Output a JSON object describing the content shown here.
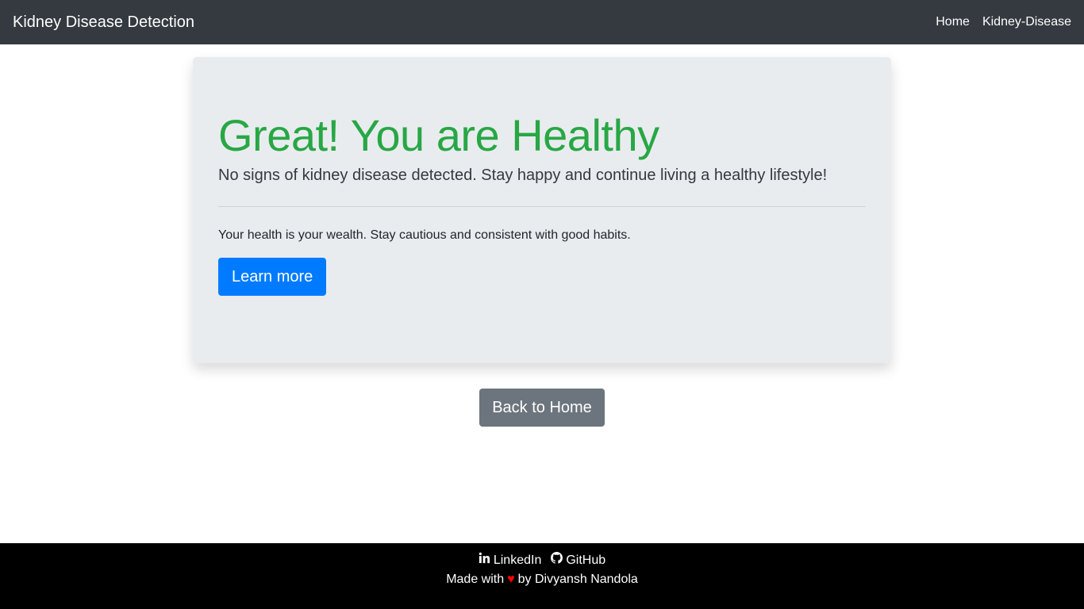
{
  "navbar": {
    "brand": "Kidney Disease Detection",
    "links": [
      "Home",
      "Kidney-Disease"
    ],
    "background": "#343a40"
  },
  "result": {
    "heading": "Great! You are Healthy",
    "lead": "No signs of kidney disease detected. Stay happy and continue living a healthy lifestyle!",
    "message": "Your health is your wealth. Stay cautious and consistent with good habits.",
    "learn_more_label": "Learn more",
    "heading_color": "#28a745",
    "button_color": "#007bff"
  },
  "back_home_label": "Back to Home",
  "footer": {
    "linkedin_label": "LinkedIn",
    "github_label": "GitHub",
    "made_with": "Made with",
    "by_text": "by Divyansh Nandola",
    "icons": [
      "linkedin-icon",
      "github-icon",
      "heart-icon"
    ],
    "heart_color": "#ff0000"
  }
}
